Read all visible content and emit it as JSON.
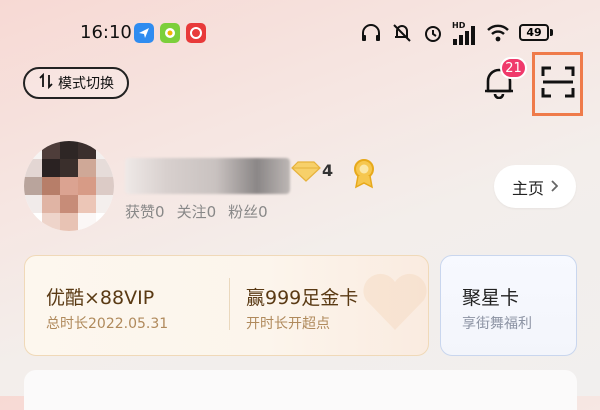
{
  "status_bar": {
    "time": "16:10",
    "battery": "49",
    "signal_label": "HD",
    "apps": [
      "share-app-icon",
      "green-app-icon",
      "music-app-icon"
    ],
    "indicators": [
      "headset-icon",
      "mute-icon",
      "alarm-icon",
      "signal-icon",
      "wifi-icon",
      "battery-icon"
    ]
  },
  "header": {
    "mode_switch_label": "模式切换",
    "notification_count": "21",
    "scan_icon": "scan-icon"
  },
  "profile": {
    "level": "4",
    "stats": {
      "likes_label": "获赞",
      "likes_value": "0",
      "following_label": "关注",
      "following_value": "0",
      "fans_label": "粉丝",
      "fans_value": "0"
    },
    "home_button_label": "主页"
  },
  "vip_card": {
    "left_title": "优酷×88VIP",
    "left_sub": "总时长2022.05.31",
    "right_title": "赢999足金卡",
    "right_sub": "开时长开超点"
  },
  "star_card": {
    "title": "聚星卡",
    "sub": "享街舞福利"
  },
  "colors": {
    "badge": "#f0396b",
    "highlight_box": "#ef7b4a",
    "vip_text": "#5a3a14"
  }
}
